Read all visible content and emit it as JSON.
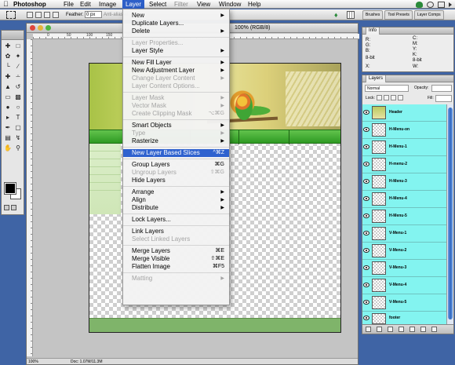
{
  "menubar": {
    "apple": "",
    "app": "Photoshop",
    "items": [
      "File",
      "Edit",
      "Image",
      "Layer",
      "Select",
      "Filter",
      "View",
      "Window",
      "Help"
    ]
  },
  "options_bar": {
    "feather_label": "Feather:",
    "feather_value": "0 px",
    "antialias_label": "Anti-aliased",
    "wells": [
      "Brushes",
      "Tool Presets",
      "Layer Comps"
    ]
  },
  "document": {
    "title": "100% (RGB/8)",
    "zoom": "100%",
    "doc_size": "Doc: 1.07M/11.3M",
    "ruler_numbers": [
      "0",
      "50",
      "100",
      "150",
      "200",
      "250",
      "300",
      "350",
      "400",
      "450",
      "500",
      "550",
      "600",
      "650",
      "700",
      "750",
      "800"
    ]
  },
  "layer_menu": {
    "items": [
      {
        "label": "New",
        "arrow": true,
        "enabled": true
      },
      {
        "label": "Duplicate Layers...",
        "enabled": true
      },
      {
        "label": "Delete",
        "arrow": true,
        "enabled": true
      },
      {
        "sep": true
      },
      {
        "label": "Layer Properties...",
        "enabled": false
      },
      {
        "label": "Layer Style",
        "arrow": true,
        "enabled": true
      },
      {
        "sep": true
      },
      {
        "label": "New Fill Layer",
        "arrow": true,
        "enabled": true
      },
      {
        "label": "New Adjustment Layer",
        "arrow": true,
        "enabled": true
      },
      {
        "label": "Change Layer Content",
        "arrow": true,
        "enabled": false
      },
      {
        "label": "Layer Content Options...",
        "enabled": false
      },
      {
        "sep": true
      },
      {
        "label": "Layer Mask",
        "arrow": true,
        "enabled": false
      },
      {
        "label": "Vector Mask",
        "arrow": true,
        "enabled": false
      },
      {
        "label": "Create Clipping Mask",
        "shortcut": "⌥⌘G",
        "enabled": false
      },
      {
        "sep": true
      },
      {
        "label": "Smart Objects",
        "arrow": true,
        "enabled": true
      },
      {
        "label": "Type",
        "arrow": true,
        "enabled": false
      },
      {
        "label": "Rasterize",
        "arrow": true,
        "enabled": true
      },
      {
        "sep": true
      },
      {
        "label": "New Layer Based Slices",
        "shortcut": "^⌘Z",
        "enabled": true,
        "highlighted": true
      },
      {
        "sep": true
      },
      {
        "label": "Group Layers",
        "shortcut": "⌘G",
        "enabled": true
      },
      {
        "label": "Ungroup Layers",
        "shortcut": "⇧⌘G",
        "enabled": false
      },
      {
        "label": "Hide Layers",
        "enabled": true
      },
      {
        "sep": true
      },
      {
        "label": "Arrange",
        "arrow": true,
        "enabled": true
      },
      {
        "label": "Align",
        "arrow": true,
        "enabled": true
      },
      {
        "label": "Distribute",
        "arrow": true,
        "enabled": true
      },
      {
        "sep": true
      },
      {
        "label": "Lock Layers...",
        "enabled": true
      },
      {
        "sep": true
      },
      {
        "label": "Link Layers",
        "enabled": true
      },
      {
        "label": "Select Linked Layers",
        "enabled": false
      },
      {
        "sep": true
      },
      {
        "label": "Merge Layers",
        "shortcut": "⌘E",
        "enabled": true
      },
      {
        "label": "Merge Visible",
        "shortcut": "⇧⌘E",
        "enabled": true
      },
      {
        "label": "Flatten Image",
        "shortcut": "⌘F5",
        "enabled": true
      },
      {
        "sep": true
      },
      {
        "label": "Matting",
        "arrow": true,
        "enabled": false
      }
    ]
  },
  "info_palette": {
    "tab": "Info",
    "r": "R:",
    "g": "G:",
    "b": "B:",
    "c": "C:",
    "m": "M:",
    "y": "Y:",
    "k": "K:",
    "bit1": "8-bit",
    "bit2": "8-bit",
    "x": "X:",
    "y2": "Y:",
    "w": "W:",
    "h": "H:"
  },
  "layers_palette": {
    "tab": "Layers",
    "blend_mode": "Normal",
    "opacity_label": "Opacity:",
    "lock_label": "Lock:",
    "fill_label": "Fill:",
    "layers": [
      "Header",
      "H-Menu-on",
      "H-Menu-1",
      "H-menu-2",
      "H-Menu-3",
      "H-Menu-4",
      "H-Menu-5",
      "V-Menu-1",
      "V-Menu-2",
      "V-Menu-3",
      "V-Menu-4",
      "V-Menu-5",
      "footer"
    ]
  },
  "colors": {
    "menu_highlight": "#2f62cf",
    "layer_row": "#83f4f0",
    "desktop": "#3f64a5",
    "site_green": "#3ba52c"
  },
  "icons": [
    "apple-icon",
    "marquee-icon",
    "eye-icon",
    "layer-thumbnail",
    "tool-icons",
    "traffic-light-close",
    "traffic-light-minimize",
    "traffic-light-zoom"
  ]
}
